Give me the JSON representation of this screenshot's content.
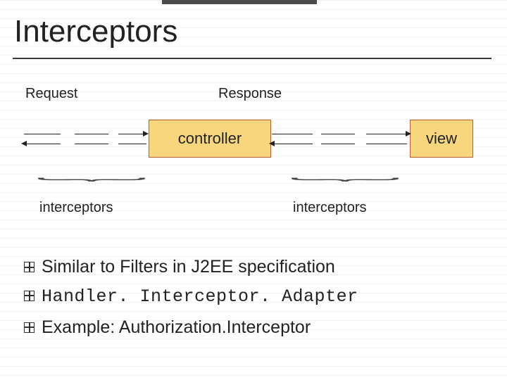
{
  "title": "Interceptors",
  "labels": {
    "request": "Request",
    "response": "Response"
  },
  "boxes": {
    "controller": "controller",
    "view": "view"
  },
  "captions": {
    "left": "interceptors",
    "right": "interceptors"
  },
  "bullets": [
    {
      "text": "Similar to Filters in J2EE specification",
      "mono": false
    },
    {
      "text": "Handler. Interceptor. Adapter",
      "mono": true
    },
    {
      "text": "Example: Authorization.Interceptor",
      "mono": false
    }
  ]
}
